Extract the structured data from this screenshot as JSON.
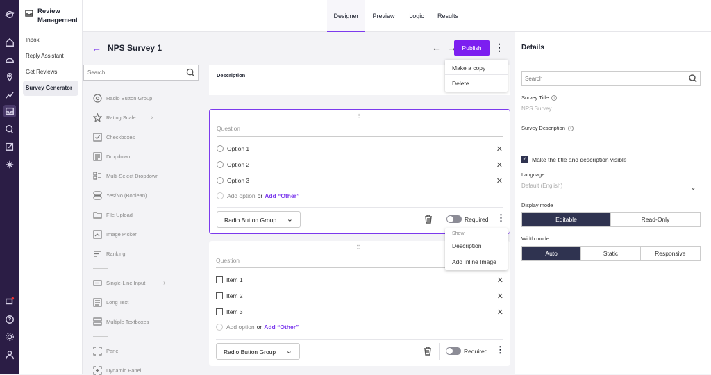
{
  "app": {
    "name": "Review Management"
  },
  "nav": {
    "items": [
      {
        "label": "Inbox"
      },
      {
        "label": "Reply Assistant"
      },
      {
        "label": "Get Reviews"
      },
      {
        "label": "Survey Generator"
      }
    ]
  },
  "tabs": [
    {
      "label": "Designer"
    },
    {
      "label": "Preview"
    },
    {
      "label": "Logic"
    },
    {
      "label": "Results"
    }
  ],
  "survey": {
    "title": "NPS Survey 1",
    "back": "←",
    "undo_redo": "← →",
    "publish_label": "Publish",
    "kebab": "⋮"
  },
  "toolbox": {
    "search_placeholder": "Search",
    "items": [
      {
        "label": "Radio Button Group"
      },
      {
        "label": "Rating Scale"
      },
      {
        "label": "Checkboxes"
      },
      {
        "label": "Dropdown"
      },
      {
        "label": "Multi-Select Dropdown"
      },
      {
        "label": "Yes/No (Boolean)"
      },
      {
        "label": "File Upload"
      },
      {
        "label": "Image Picker"
      },
      {
        "label": "Ranking"
      },
      {
        "label": "Single-Line Input"
      },
      {
        "label": "Long Text"
      },
      {
        "label": "Multiple Textboxes"
      },
      {
        "label": "Panel"
      },
      {
        "label": "Dynamic Panel"
      }
    ]
  },
  "canvas": {
    "description_label": "Description",
    "top_menu": {
      "items": [
        {
          "label": "Make a copy"
        },
        {
          "label": "Delete"
        }
      ]
    },
    "q1": {
      "placeholder": "Question",
      "options": [
        {
          "label": "Option 1"
        },
        {
          "label": "Option 2"
        },
        {
          "label": "Option 3"
        }
      ],
      "add_option": "Add option",
      "or": "or",
      "add_other": "Add “Other”",
      "type": "Radio Button Group",
      "required": "Required",
      "drag": "⠿"
    },
    "show_menu": {
      "header": "Show",
      "items": [
        {
          "label": "Description"
        },
        {
          "label": "Add Inline Image"
        }
      ]
    },
    "q2": {
      "placeholder": "Question",
      "items": [
        {
          "label": "Item 1"
        },
        {
          "label": "Item 2"
        },
        {
          "label": "Item 3"
        }
      ],
      "add_option": "Add option",
      "or": "or",
      "add_other": "Add “Other”",
      "type": "Radio Button Group",
      "required": "Required",
      "drag": "⠿"
    }
  },
  "details": {
    "title": "Details",
    "search_placeholder": "Search",
    "survey_title_label": "Survey Title",
    "survey_title_placeholder": "NPS Survey",
    "survey_desc_label": "Survey Description",
    "visible_label": "Make the title and description visible",
    "visible_checked": true,
    "language_label": "Language",
    "language_value": "Default (English)",
    "display_mode_label": "Display mode",
    "display_modes": [
      {
        "label": "Editable"
      },
      {
        "label": "Read-Only"
      }
    ],
    "display_mode_selected": "Editable",
    "width_mode_label": "Width mode",
    "width_modes": [
      {
        "label": "Auto"
      },
      {
        "label": "Static"
      },
      {
        "label": "Responsive"
      }
    ],
    "width_mode_selected": "Auto"
  },
  "colors": {
    "accent": "#7c1ff0",
    "rail": "#2b1d45",
    "segment_on": "#2f3350"
  }
}
